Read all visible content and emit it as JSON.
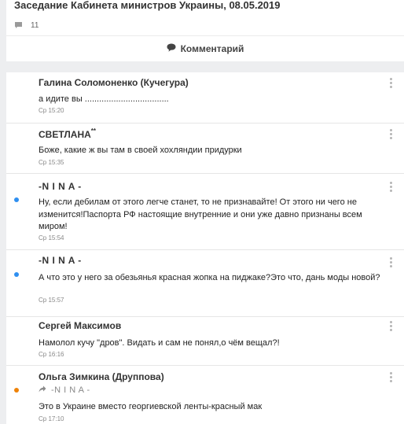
{
  "post": {
    "title": "Заседание Кабинета министров Украины, 08.05.2019",
    "comments_count": "11",
    "comment_button": "Комментарий"
  },
  "comments": [
    {
      "author": "Галина Соломоненко (Кучегура)",
      "text": "а идите вы ...................................",
      "time": "Ср 15:20",
      "unread": false
    },
    {
      "author": "СВЕТЛАНА",
      "author_badge": "**",
      "text": "Боже, какие ж вы там  в своей хохляндии придурки",
      "time": "Ср 15:35",
      "unread": false
    },
    {
      "author": "-N I N A -",
      "text": "Ну, если дебилам от этого легче станет, то не признавайте! От этого ни чего не изменится!Паспорта РФ настоящие внутренние и они уже давно признаны всем миром!",
      "time": "Ср 15:54",
      "unread": true
    },
    {
      "author": "-N I N A -",
      "text": "А что это у него за обезьянья красная жопка на пиджаке?Это что, дань моды новой?",
      "time": "Ср 15:57",
      "unread": true
    },
    {
      "author": "Сергей Максимов",
      "text": "Намолол кучу \"дров\". Видать и сам не понял,о чём вещал?!",
      "time": "Ср 16:16",
      "unread": false
    },
    {
      "author": "Ольга Зимкина (Друппова)",
      "reply_to": "-N I N A -",
      "text": "Это в Украине вместо георгиевской ленты-красный мак",
      "time": "Ср 17:10",
      "unread": true
    }
  ],
  "colors": {
    "unread_blue": "#2f8ff0",
    "unread_orange": "#ee8208",
    "page_bg": "#edeef0"
  }
}
